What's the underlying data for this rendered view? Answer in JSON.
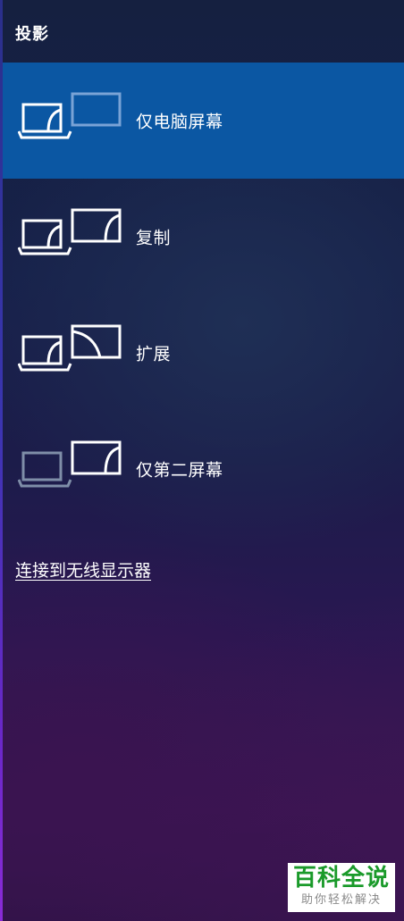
{
  "panel": {
    "title": "投影"
  },
  "options": [
    {
      "label": "仅电脑屏幕",
      "selected": true,
      "icon": "pc-screen-only-icon"
    },
    {
      "label": "复制",
      "selected": false,
      "icon": "duplicate-icon"
    },
    {
      "label": "扩展",
      "selected": false,
      "icon": "extend-icon"
    },
    {
      "label": "仅第二屏幕",
      "selected": false,
      "icon": "second-screen-only-icon"
    }
  ],
  "wireless": {
    "label": "连接到无线显示器"
  },
  "watermark": {
    "main": "百科全说",
    "sub": "助你轻松解决"
  },
  "colors": {
    "selected_background": "#0b57a3",
    "text": "#ffffff",
    "dim_icon": "#7f8ea8",
    "watermark_green": "#1a9a2a"
  }
}
